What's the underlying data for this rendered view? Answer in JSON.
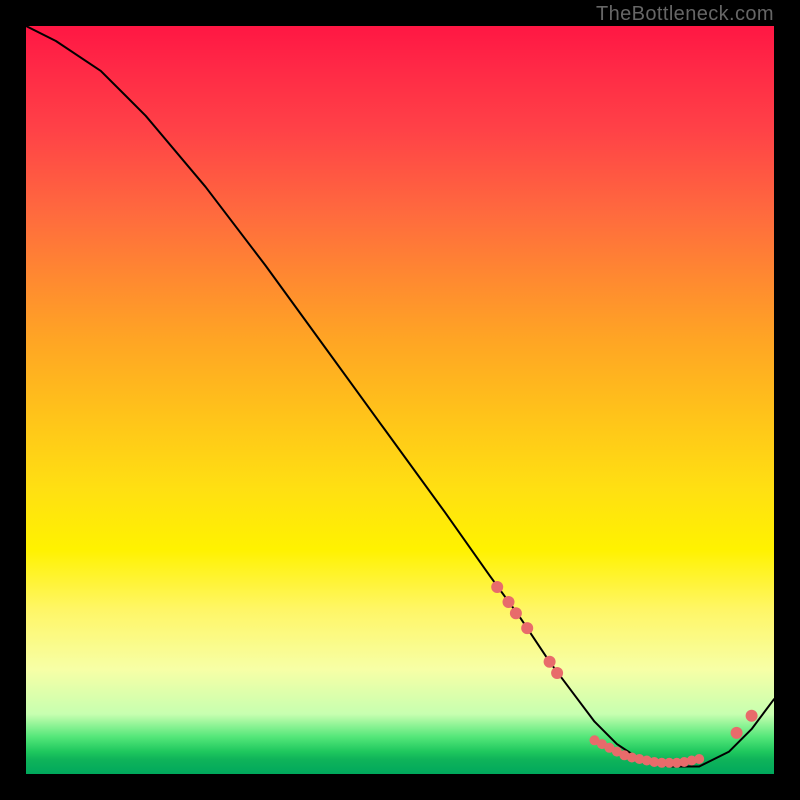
{
  "attribution": "TheBottleneck.com",
  "colors": {
    "bg": "#000000",
    "curve": "#000000",
    "point": "#e86b6b",
    "gradient_top": "#ff1744",
    "gradient_bottom": "#00a85c"
  },
  "chart_data": {
    "type": "line",
    "title": "",
    "xlabel": "",
    "ylabel": "",
    "xlim": [
      0,
      100
    ],
    "ylim": [
      0,
      100
    ],
    "grid": false,
    "legend": false,
    "series": [
      {
        "name": "bottleneck-curve",
        "x": [
          0,
          4,
          10,
          16,
          24,
          32,
          40,
          48,
          56,
          62,
          66,
          70,
          73,
          76,
          79,
          82,
          86,
          90,
          94,
          97,
          100
        ],
        "y": [
          100,
          98,
          94,
          88,
          78.5,
          68,
          57,
          46,
          35,
          26.5,
          21,
          15,
          11,
          7,
          4,
          2,
          1,
          1,
          3,
          6,
          10
        ]
      }
    ],
    "points": [
      {
        "x": 63,
        "y": 25
      },
      {
        "x": 64.5,
        "y": 23
      },
      {
        "x": 65.5,
        "y": 21.5
      },
      {
        "x": 67,
        "y": 19.5
      },
      {
        "x": 70,
        "y": 15
      },
      {
        "x": 71,
        "y": 13.5
      },
      {
        "x": 76,
        "y": 4.5
      },
      {
        "x": 77,
        "y": 4
      },
      {
        "x": 78,
        "y": 3.5
      },
      {
        "x": 79,
        "y": 3
      },
      {
        "x": 80,
        "y": 2.5
      },
      {
        "x": 81,
        "y": 2.2
      },
      {
        "x": 82,
        "y": 2
      },
      {
        "x": 83,
        "y": 1.8
      },
      {
        "x": 84,
        "y": 1.6
      },
      {
        "x": 85,
        "y": 1.5
      },
      {
        "x": 86,
        "y": 1.5
      },
      {
        "x": 87,
        "y": 1.5
      },
      {
        "x": 88,
        "y": 1.6
      },
      {
        "x": 89,
        "y": 1.8
      },
      {
        "x": 90,
        "y": 2
      },
      {
        "x": 95,
        "y": 5.5
      },
      {
        "x": 97,
        "y": 7.8
      }
    ],
    "point_radius_large": 6,
    "point_radius_small": 5
  }
}
